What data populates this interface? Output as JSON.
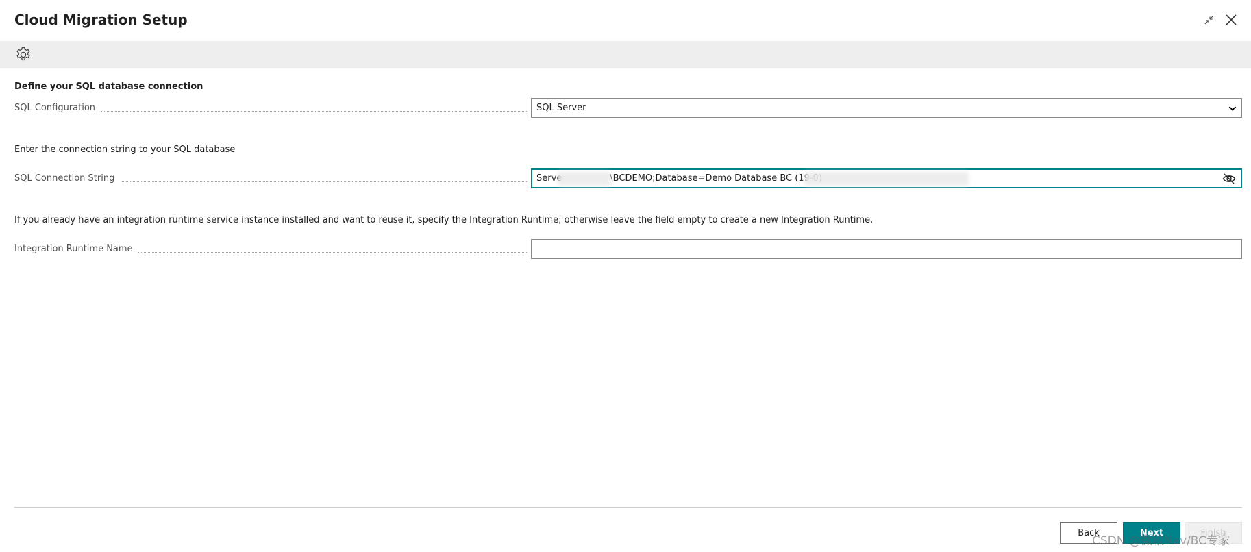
{
  "header": {
    "title": "Cloud Migration Setup"
  },
  "sections": {
    "database_title": "Define your SQL database connection",
    "connection_instruction": "Enter the connection string to your SQL database",
    "runtime_instruction": "If you already have an integration runtime service instance installed and want to reuse it, specify the Integration Runtime; otherwise leave the field empty to create a new Integration Runtime."
  },
  "fields": {
    "sql_configuration": {
      "label": "SQL Configuration",
      "value": "SQL Server"
    },
    "sql_connection_string": {
      "label": "SQL Connection String",
      "value_prefix": "Serve",
      "value_visible": "\\BCDEMO;Database=Demo Database BC (19-0)"
    },
    "integration_runtime_name": {
      "label": "Integration Runtime Name",
      "value": ""
    }
  },
  "footer": {
    "back_label": "Back",
    "next_label": "Next",
    "finish_label": "Finish"
  },
  "watermark": "CSDN @微软Nav/BC专家",
  "colors": {
    "accent": "#00828a",
    "action_bar": "#eeeeee",
    "disabled_bg": "#f0f0f0"
  },
  "icons": {
    "settings": "gear-icon",
    "collapse": "collapse-icon",
    "close": "close-icon",
    "dropdown": "chevron-down-icon",
    "hide_value": "eye-off-icon"
  }
}
